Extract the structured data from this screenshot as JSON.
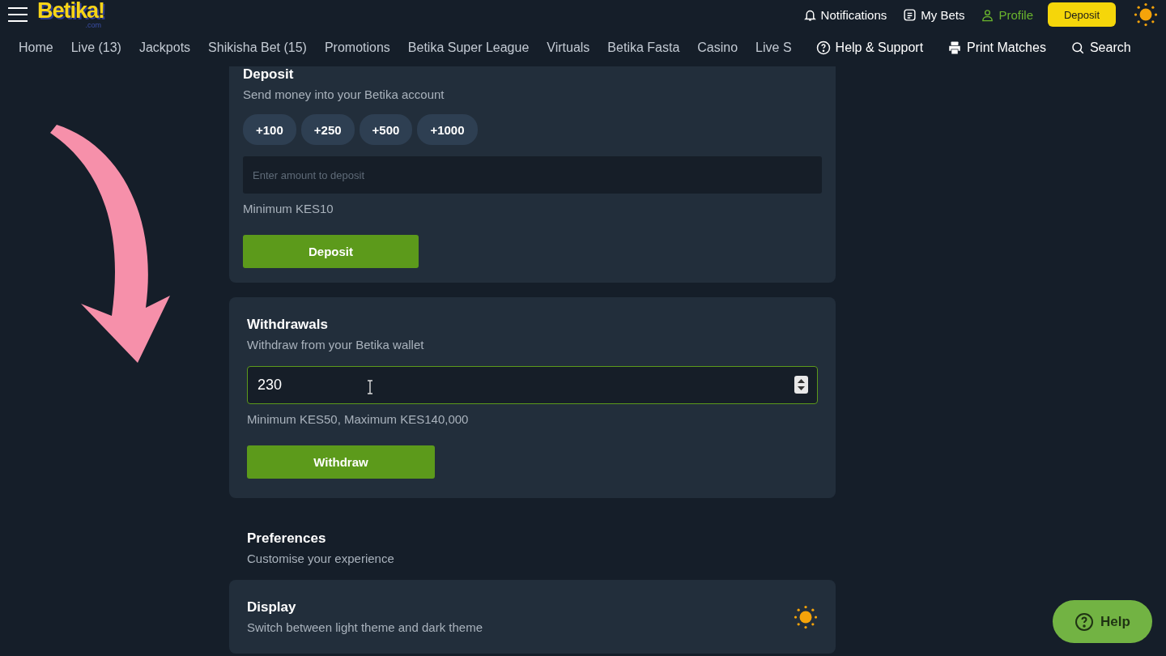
{
  "header": {
    "logo": {
      "main": "Betika!",
      "sub": ".com"
    },
    "actions": [
      {
        "kind": "bell",
        "label": "Notifications",
        "selected": false
      },
      {
        "kind": "list",
        "label": "My Bets",
        "selected": false
      },
      {
        "kind": "user",
        "label": "Profile",
        "selected": true
      }
    ],
    "deposit_button": "Deposit"
  },
  "nav": {
    "items": [
      {
        "label": "Home"
      },
      {
        "label": "Live (13)"
      },
      {
        "label": "Jackpots"
      },
      {
        "label": "Shikisha Bet (15)"
      },
      {
        "label": "Promotions"
      },
      {
        "label": "Betika Super League"
      },
      {
        "label": "Virtuals"
      },
      {
        "label": "Betika Fasta"
      },
      {
        "label": "Casino"
      },
      {
        "label": "Live S"
      }
    ],
    "tools": [
      {
        "kind": "help",
        "label": "Help & Support"
      },
      {
        "kind": "print",
        "label": "Print Matches"
      },
      {
        "kind": "search",
        "label": "Search"
      }
    ]
  },
  "deposit": {
    "title": "Deposit",
    "subtitle": "Send money into your Betika account",
    "quick_amounts": [
      "+100",
      "+250",
      "+500",
      "+1000"
    ],
    "placeholder": "Enter amount to deposit",
    "note": "Minimum KES10",
    "button": "Deposit"
  },
  "withdrawals": {
    "title": "Withdrawals",
    "subtitle": "Withdraw from your Betika wallet",
    "value": "230",
    "note": "Minimum KES50, Maximum KES140,000",
    "button": "Withdraw"
  },
  "preferences": {
    "title": "Preferences",
    "subtitle": "Customise your experience"
  },
  "display": {
    "title": "Display",
    "subtitle": "Switch between light theme and dark theme"
  },
  "help_button": "Help",
  "annotation": {
    "kind": "arrow"
  }
}
